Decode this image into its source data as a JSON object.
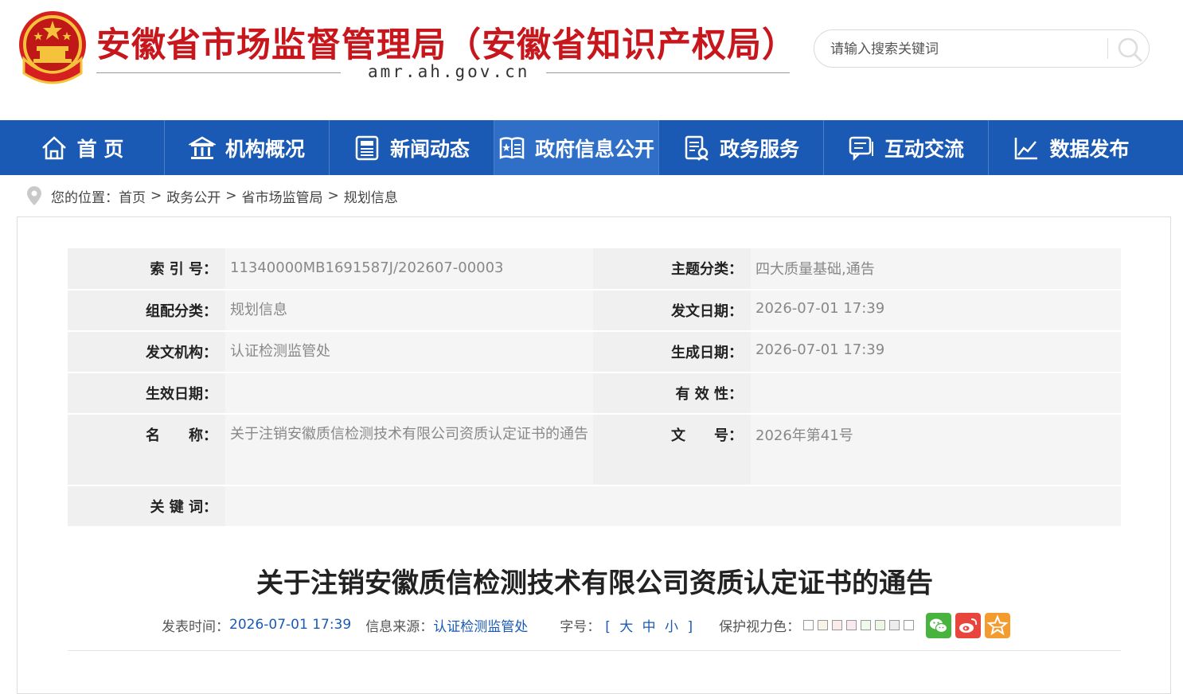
{
  "header": {
    "title": "安徽省市场监督管理局（安徽省知识产权局）",
    "domain": "amr.ah.gov.cn",
    "search_placeholder": "请输入搜索关键词"
  },
  "nav": {
    "items": [
      {
        "label": "首 页",
        "icon": "home-icon"
      },
      {
        "label": "机构概况",
        "icon": "building-icon"
      },
      {
        "label": "新闻动态",
        "icon": "news-icon"
      },
      {
        "label": "政府信息公开",
        "icon": "gov-info-icon"
      },
      {
        "label": "政务服务",
        "icon": "service-icon"
      },
      {
        "label": "互动交流",
        "icon": "chat-icon"
      },
      {
        "label": "数据发布",
        "icon": "chart-icon"
      }
    ],
    "active_index": 3
  },
  "breadcrumb": {
    "prefix": "您的位置：",
    "items": [
      "首页",
      "政务公开",
      "省市场监管局",
      "规划信息"
    ],
    "separator": ">"
  },
  "meta": {
    "index_label": "索 引 号：",
    "index_value": "11340000MB1691587J/202607-00003",
    "topic_label": "主题分类：",
    "topic_value": "四大质量基础,通告",
    "group_label": "组配分类：",
    "group_value": "规划信息",
    "pubdate_label": "发文日期：",
    "pubdate_value": "2026-07-01 17:39",
    "org_label": "发文机构：",
    "org_value": "认证检测监管处",
    "gendate_label": "生成日期：",
    "gendate_value": "2026-07-01 17:39",
    "effdate_label": "生效日期：",
    "effdate_value": "",
    "validity_label": "有 效 性：",
    "validity_value": "",
    "name_label": "名　　称：",
    "name_value": "关于注销安徽质信检测技术有限公司资质认定证书的通告",
    "docno_label": "文　　号：",
    "docno_value": "2026年第41号",
    "keywords_label": "关 键 词：",
    "keywords_value": ""
  },
  "article": {
    "title": "关于注销安徽质信检测技术有限公司资质认定证书的通告",
    "time_label": "发表时间：",
    "time_value": "2026-07-01 17:39",
    "source_label": "信息来源：",
    "source_value": "认证检测监管处",
    "fontsize_label": "字号：",
    "fontsize_options": "[ 大 中 小 ]",
    "eyecolor_label": "保护视力色："
  },
  "colors": {
    "brand_red": "#c8161d",
    "nav_blue": "#1b5ab4",
    "swatches": [
      "#ffffff",
      "#faf3e8",
      "#fcebeb",
      "#fbe9f2",
      "#eff9ec",
      "#eef7e6",
      "#ededed",
      "#ffffff"
    ],
    "wechat": "#48b33f",
    "weibo": "#e8453c",
    "favorite": "#f39b2e"
  }
}
